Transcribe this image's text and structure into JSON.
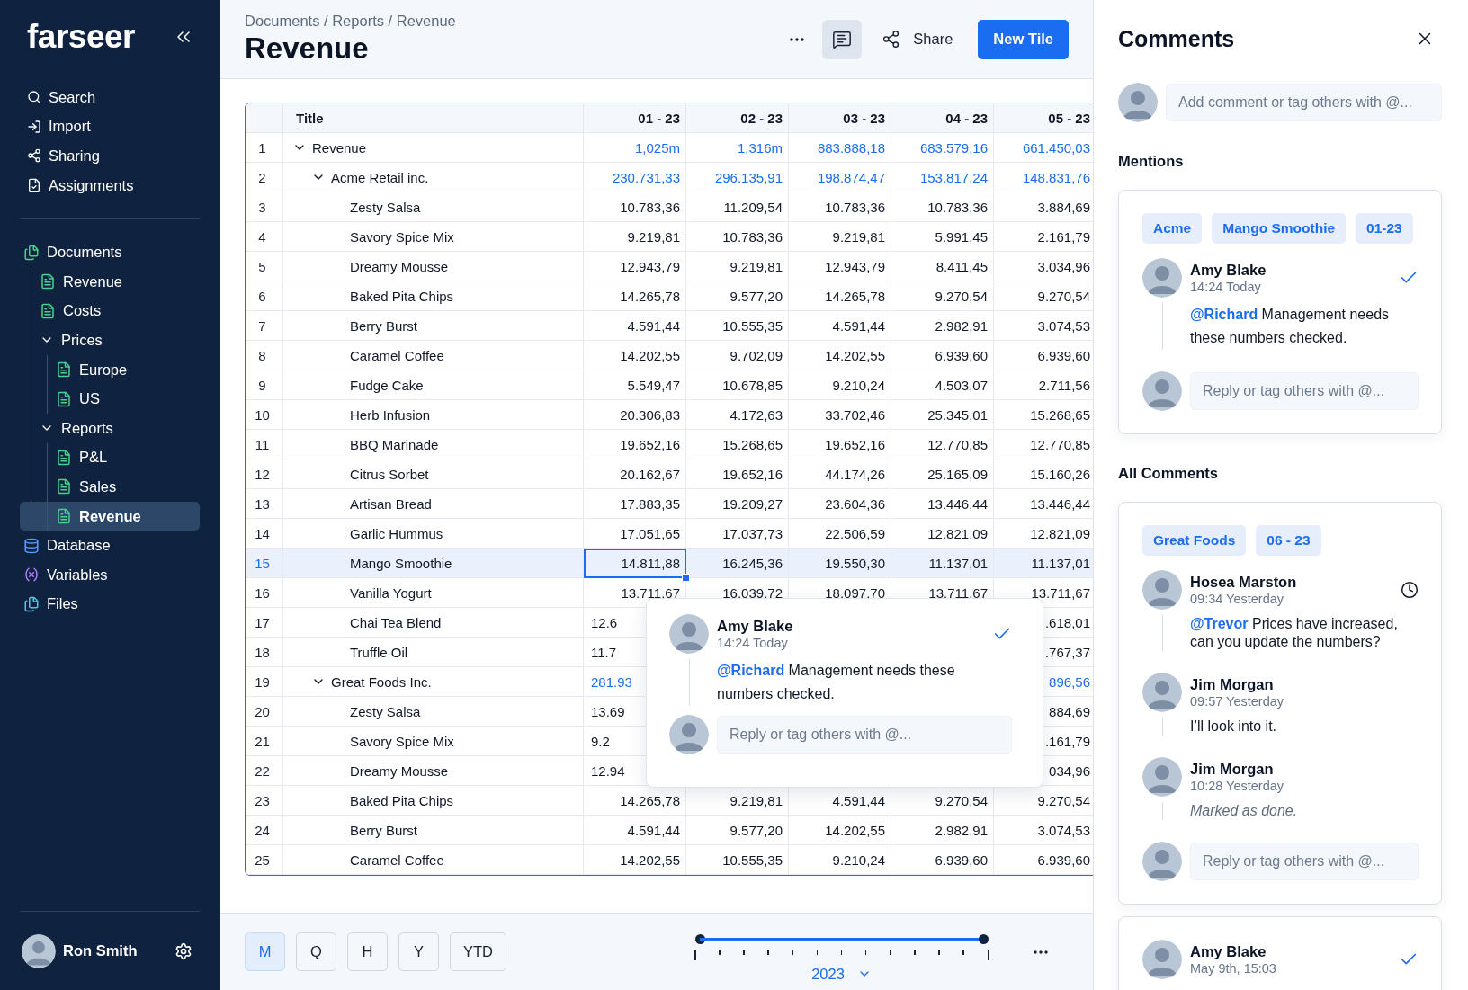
{
  "sidebar": {
    "logo": "farseer",
    "nav": [
      {
        "label": "Search",
        "kind": "search"
      },
      {
        "label": "Import",
        "kind": "import"
      },
      {
        "label": "Sharing",
        "kind": "sharing"
      },
      {
        "label": "Assignments",
        "kind": "assignments"
      }
    ],
    "tree": [
      {
        "label": "Documents",
        "kind": "documents",
        "selected": false,
        "children": [
          {
            "label": "Revenue",
            "kind": "document",
            "selected": false
          },
          {
            "label": "Costs",
            "kind": "document",
            "selected": false
          },
          {
            "label": "Prices",
            "kind": "folder",
            "expanded": true,
            "selected": false,
            "children": [
              {
                "label": "Europe",
                "kind": "document",
                "selected": false
              },
              {
                "label": "US",
                "kind": "document",
                "selected": false
              }
            ]
          },
          {
            "label": "Reports",
            "kind": "folder",
            "expanded": true,
            "selected": false,
            "children": [
              {
                "label": "P&L",
                "kind": "document",
                "selected": false
              },
              {
                "label": "Sales",
                "kind": "document",
                "selected": false
              },
              {
                "label": "Revenue",
                "kind": "document",
                "selected": true
              }
            ]
          }
        ]
      },
      {
        "label": "Database",
        "kind": "database",
        "selected": false
      },
      {
        "label": "Variables",
        "kind": "variables",
        "selected": false
      },
      {
        "label": "Files",
        "kind": "files",
        "selected": false
      }
    ],
    "user": {
      "name": "Ron Smith"
    }
  },
  "header": {
    "breadcrumb": "Documents / Reports / Revenue",
    "title": "Revenue",
    "comments_on": true,
    "share": "Share",
    "new_tile": "New Tile"
  },
  "table": {
    "columns": [
      "Title",
      "01 - 23",
      "02 - 23",
      "03 - 23",
      "04 - 23",
      "05 - 23"
    ],
    "rows": [
      {
        "num": "1",
        "title": "Revenue",
        "expanded": true,
        "selected": false,
        "values": [
          "1,025m",
          "1,316m",
          "883.888,18",
          "683.579,16",
          "661.450,03"
        ],
        "children": [
          {
            "num": "2",
            "title": "Acme Retail inc.",
            "expanded": true,
            "selected": false,
            "values": [
              "230.731,33",
              "296.135,91",
              "198.874,47",
              "153.817,24",
              "148.831,76"
            ],
            "children": [
              {
                "num": "3",
                "title": "Zesty Salsa",
                "selected": false,
                "values": [
                  "10.783,36",
                  "11.209,54",
                  "10.783,36",
                  "10.783,36",
                  "3.884,69"
                ]
              },
              {
                "num": "4",
                "title": "Savory Spice Mix",
                "selected": false,
                "values": [
                  "9.219,81",
                  "10.783,36",
                  "9.219,81",
                  "5.991,45",
                  "2.161,79"
                ]
              },
              {
                "num": "5",
                "title": "Dreamy Mousse",
                "selected": false,
                "values": [
                  "12.943,79",
                  "9.219,81",
                  "12.943,79",
                  "8.411,45",
                  "3.034,96"
                ]
              },
              {
                "num": "6",
                "title": "Baked Pita Chips",
                "selected": false,
                "values": [
                  "14.265,78",
                  "9.577,20",
                  "14.265,78",
                  "9.270,54",
                  "9.270,54"
                ]
              },
              {
                "num": "7",
                "title": "Berry Burst",
                "selected": false,
                "values": [
                  "4.591,44",
                  "10.555,35",
                  "4.591,44",
                  "2.982,91",
                  "3.074,53"
                ]
              },
              {
                "num": "8",
                "title": "Caramel Coffee",
                "selected": false,
                "values": [
                  "14.202,55",
                  "9.702,09",
                  "14.202,55",
                  "6.939,60",
                  "6.939,60"
                ]
              },
              {
                "num": "9",
                "title": "Fudge Cake",
                "selected": false,
                "values": [
                  "5.549,47",
                  "10.678,85",
                  "9.210,24",
                  "4.503,07",
                  "2.711,56"
                ]
              },
              {
                "num": "10",
                "title": "Herb Infusion",
                "selected": false,
                "values": [
                  "20.306,83",
                  "4.172,63",
                  "33.702,46",
                  "25.345,01",
                  "15.268,65"
                ]
              },
              {
                "num": "11",
                "title": "BBQ Marinade",
                "selected": false,
                "values": [
                  "19.652,16",
                  "15.268,65",
                  "19.652,16",
                  "12.770,85",
                  "12.770,85"
                ]
              },
              {
                "num": "12",
                "title": "Citrus Sorbet",
                "selected": false,
                "values": [
                  "20.162,67",
                  "19.652,16",
                  "44.174,26",
                  "25.165,09",
                  "15.160,26"
                ]
              },
              {
                "num": "13",
                "title": "Artisan Bread",
                "selected": false,
                "values": [
                  "17.883,35",
                  "19.209,27",
                  "23.604,36",
                  "13.446,44",
                  "13.446,44"
                ]
              },
              {
                "num": "14",
                "title": "Garlic Hummus",
                "selected": false,
                "values": [
                  "17.051,65",
                  "17.037,73",
                  "22.506,59",
                  "12.821,09",
                  "12.821,09"
                ]
              },
              {
                "num": "15",
                "title": "Mango Smoothie",
                "selected": true,
                "values": [
                  "14.811,88",
                  "16.245,36",
                  "19.550,30",
                  "11.137,01",
                  "11.137,01"
                ]
              },
              {
                "num": "16",
                "title": "Vanilla Yogurt",
                "selected": false,
                "values": [
                  "13.711,67",
                  "16.039,72",
                  "18.097,70",
                  "13.711,67",
                  "13.711,67"
                ]
              },
              {
                "num": "17",
                "title": "Chai Tea Blend",
                "selected": false,
                "first_value": "12.6",
                "last_value": ".618,01"
              },
              {
                "num": "18",
                "title": "Truffle Oil",
                "selected": false,
                "first_value": "11.7",
                "last_value": ".767,37"
              }
            ]
          },
          {
            "num": "19",
            "title": "Great Foods Inc.",
            "expanded": true,
            "selected": false,
            "first_value": "281.93",
            "last_value": "896,56",
            "children": [
              {
                "num": "20",
                "title": "Zesty Salsa",
                "selected": false,
                "first_value": "13.69",
                "last_value": "884,69"
              },
              {
                "num": "21",
                "title": "Savory Spice Mix",
                "selected": false,
                "first_value": "9.2",
                "last_value": ".161,79"
              },
              {
                "num": "22",
                "title": "Dreamy Mousse",
                "selected": false,
                "first_value": "12.94",
                "last_value": "034,96"
              },
              {
                "num": "23",
                "title": "Baked Pita Chips",
                "selected": false,
                "values": [
                  "14.265,78",
                  "9.219,81",
                  "4.591,44",
                  "9.270,54",
                  "9.270,54"
                ]
              },
              {
                "num": "24",
                "title": "Berry Burst",
                "selected": false,
                "values": [
                  "4.591,44",
                  "9.577,20",
                  "14.202,55",
                  "2.982,91",
                  "3.074,53"
                ]
              },
              {
                "num": "25",
                "title": "Caramel Coffee",
                "selected": false,
                "values": [
                  "14.202,55",
                  "10.555,35",
                  "9.210,24",
                  "6.939,60",
                  "6.939,60"
                ]
              }
            ]
          }
        ]
      }
    ]
  },
  "popover": {
    "comment": {
      "author": "Amy Blake",
      "time": "14:24 Today",
      "resolved": true,
      "body": "**@Richard** Management needs these numbers checked."
    },
    "reply_placeholder": "Reply or tag others with @..."
  },
  "bottom_bar": {
    "periods": [
      {
        "label": "M",
        "selected": true
      },
      {
        "label": "Q",
        "selected": false
      },
      {
        "label": "H",
        "selected": false
      },
      {
        "label": "Y",
        "selected": false
      },
      {
        "label": "YTD",
        "selected": false
      }
    ],
    "timeline": {
      "level": 1,
      "year": "2023"
    }
  },
  "comments_panel": {
    "title": "Comments",
    "add_placeholder": "Add comment or tag others with @...",
    "sections": [
      {
        "heading": "Mentions",
        "threads": [
          {
            "tags": [
              "Acme",
              "Mango Smoothie",
              "01-23"
            ],
            "comments": [
              {
                "author": "Amy Blake",
                "time": "14:24 Today",
                "resolved": true,
                "kind": "message",
                "body": "**@Richard** Management needs these numbers checked."
              }
            ],
            "reply_placeholder": "Reply or tag others with @..."
          }
        ]
      },
      {
        "heading": "All Comments",
        "threads": [
          {
            "tags": [
              "Great Foods",
              "06 - 23"
            ],
            "comments": [
              {
                "author": "Hosea Marston",
                "time": "09:34 Yesterday",
                "reminder": true,
                "kind": "message",
                "body": "**@Trevor** Prices have increased, can you update the numbers?"
              },
              {
                "author": "Jim Morgan",
                "time": "09:57 Yesterday",
                "kind": "message",
                "body": "I’ll look into it."
              },
              {
                "author": "Jim Morgan",
                "time": "10:28 Yesterday",
                "kind": "event",
                "body": "Marked as done."
              }
            ],
            "reply_placeholder": "Reply or tag others with @..."
          },
          {
            "comments": [
              {
                "author": "Amy Blake",
                "time": "May 9th, 15:03",
                "resolved": true
              }
            ]
          }
        ]
      }
    ]
  }
}
